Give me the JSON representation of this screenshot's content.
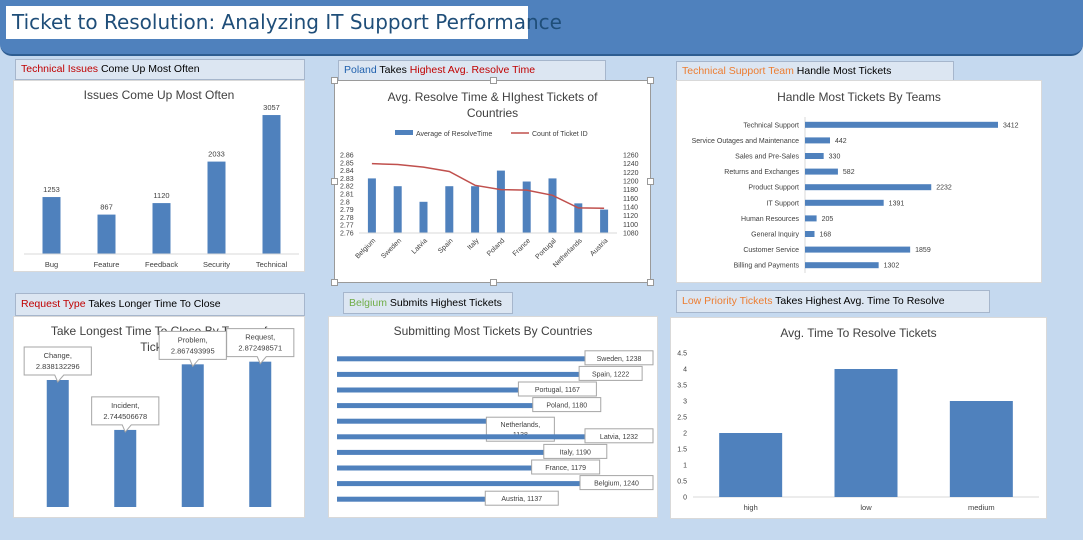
{
  "header": {
    "title": "Ticket to Resolution: Analyzing IT Support Performance"
  },
  "labels": {
    "issues": {
      "highlight": "Technical Issues",
      "rest": " Come Up Most Often"
    },
    "poland": {
      "highlight": "Poland",
      "mid": " Takes ",
      "highlight2": "Highest Avg. Resolve Time"
    },
    "teams": {
      "highlight": "Technical Support Team",
      "rest": " Handle Most Tickets"
    },
    "request": {
      "highlight": "Request Type",
      "rest": " Takes Longer Time To Close"
    },
    "belgium": {
      "highlight": "Belgium",
      "rest": " Submits Highest Tickets"
    },
    "priority": {
      "highlight": "Low Priority Tickets",
      "rest": " Takes Highest Avg. Time To Resolve"
    }
  },
  "colors": {
    "bar": "#4f81bd",
    "line": "#c0504d",
    "highlight_red": "#c00000",
    "highlight_blue": "#1f60ad",
    "highlight_orange": "#ed7d31",
    "highlight_green": "#70ad47"
  },
  "chart_data": [
    {
      "id": "issues",
      "type": "bar",
      "title": "Issues Come Up Most Often",
      "categories": [
        "Bug",
        "Feature",
        "Feedback",
        "Security",
        "Technical"
      ],
      "values": [
        1253,
        867,
        1120,
        2033,
        3057
      ],
      "ylim": [
        0,
        3300
      ]
    },
    {
      "id": "countries_combo",
      "type": "bar",
      "title": "Avg. Resolve Time & HIghest Tickets of Countries",
      "categories": [
        "Belgium",
        "Sweden",
        "Latvia",
        "Spain",
        "Italy",
        "Poland",
        "France",
        "Portugal",
        "Netherlands",
        "Austria"
      ],
      "series": [
        {
          "name": "Average of ResolveTime",
          "type": "bar",
          "values": [
            2.83,
            2.82,
            2.8,
            2.82,
            2.82,
            2.84,
            2.826,
            2.83,
            2.798,
            2.79
          ]
        },
        {
          "name": "Count of Ticket ID",
          "type": "line",
          "values": [
            1240,
            1238,
            1232,
            1222,
            1190,
            1180,
            1179,
            1167,
            1138,
            1137
          ]
        }
      ],
      "y_left": {
        "ylim": [
          2.76,
          2.86
        ],
        "ticks": [
          "2.86",
          "2.85",
          "2.84",
          "2.83",
          "2.82",
          "2.81",
          "2.8",
          "2.79",
          "2.78",
          "2.77",
          "2.76"
        ]
      },
      "y_right": {
        "ylim": [
          1080,
          1260
        ],
        "ticks": [
          "1260",
          "1240",
          "1220",
          "1200",
          "1180",
          "1160",
          "1140",
          "1120",
          "1100",
          "1080"
        ]
      },
      "legend": "top"
    },
    {
      "id": "teams",
      "type": "bar",
      "title": "Handle Most Tickets By Teams",
      "categories": [
        "Technical Support",
        "Service Outages and Maintenance",
        "Sales and Pre-Sales",
        "Returns and Exchanges",
        "Product Support",
        "IT Support",
        "Human Resources",
        "General Inquiry",
        "Customer Service",
        "Billing and Payments"
      ],
      "values": [
        3412,
        442,
        330,
        582,
        2232,
        1391,
        205,
        168,
        1859,
        1302
      ],
      "orientation": "horizontal"
    },
    {
      "id": "types",
      "type": "bar",
      "title": "Take Longest Time To Close By Types of Tickets",
      "categories": [
        "Change",
        "Incident",
        "Problem",
        "Request"
      ],
      "values": [
        2.838132296,
        2.744506678,
        2.867493995,
        2.872498571
      ],
      "data_labels": [
        "Change, 2.838132296",
        "Incident, 2.744506678",
        "Problem, 2.867493995",
        "Request, 2.872498571"
      ]
    },
    {
      "id": "country_tickets",
      "type": "bar",
      "title": "Submitting Most Tickets By Countries",
      "categories": [
        "Sweden",
        "Spain",
        "Portugal",
        "Poland",
        "Netherlands",
        "Latvia",
        "Italy",
        "France",
        "Belgium",
        "Austria"
      ],
      "values": [
        1238,
        1222,
        1167,
        1180,
        1138,
        1232,
        1190,
        1179,
        1240,
        1137
      ],
      "data_labels": [
        "Sweden, 1238",
        "Spain, 1222",
        "Portugal, 1167",
        "Poland, 1180",
        "Netherlands, 1138",
        "Latvia, 1232",
        "Italy, 1190",
        "France, 1179",
        "Belgium, 1240",
        "Austria, 1137"
      ],
      "orientation": "horizontal"
    },
    {
      "id": "priority",
      "type": "bar",
      "title": "Avg. Time To Resolve Tickets",
      "categories": [
        "high",
        "low",
        "medium"
      ],
      "values": [
        2.0,
        4.0,
        3.0
      ],
      "ylim": [
        0,
        4.5
      ],
      "y_ticks": [
        "4.5",
        "4",
        "3.5",
        "3",
        "2.5",
        "2",
        "1.5",
        "1",
        "0.5",
        "0"
      ]
    }
  ]
}
